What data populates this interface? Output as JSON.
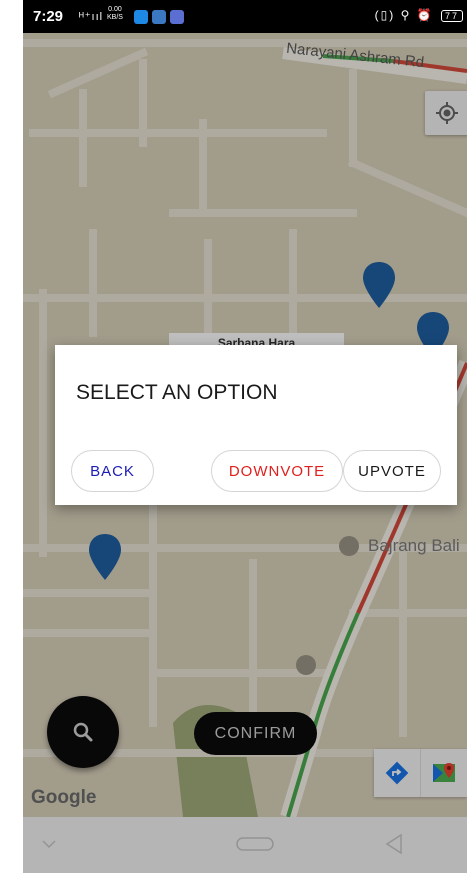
{
  "status_bar": {
    "time": "7:29",
    "signal": "ᴴ⁺ııl",
    "speed_value": "0.00",
    "speed_unit": "KB/S",
    "right_icons": "(▯) ⚲ ⏰",
    "battery": "77"
  },
  "map": {
    "road_label": "Narayani Ashram Rd",
    "poi_label": "Bajrang Bali",
    "label_bar": "Sarbana Hara",
    "google_logo": "Google"
  },
  "fab": {
    "icon": "search-icon"
  },
  "confirm_label": "CONFIRM",
  "dialog": {
    "title": "SELECT AN OPTION",
    "back_label": "BACK",
    "downvote_label": "DOWNVOTE",
    "upvote_label": "UPVOTE"
  },
  "colors": {
    "pin": "#1e5fa0",
    "back_text": "#1c1cb5",
    "downvote_text": "#e0201c",
    "map_bg": "#d9d0ba"
  }
}
